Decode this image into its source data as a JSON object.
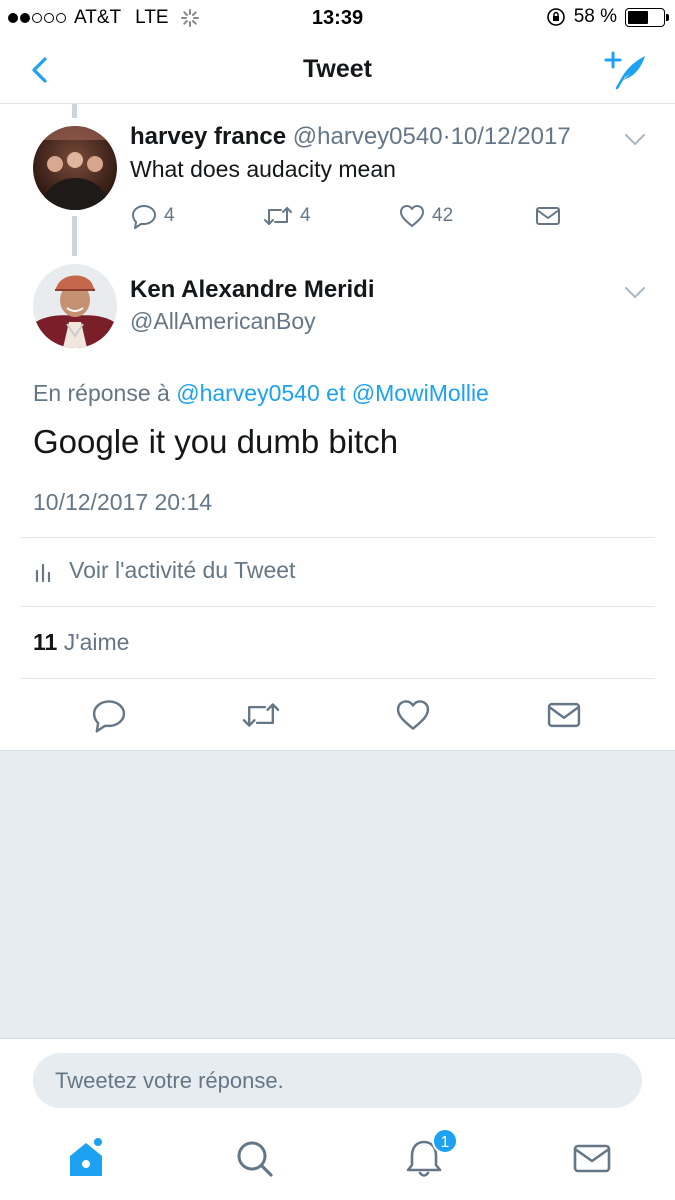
{
  "status_bar": {
    "carrier": "AT&T",
    "network": "LTE",
    "time": "13:39",
    "battery_text": "58 %",
    "battery_level": 0.58
  },
  "nav": {
    "title": "Tweet"
  },
  "parent_tweet": {
    "name": "harvey france",
    "handle": "@harvey0540",
    "separator": "·",
    "date": "10/12/2017",
    "text": "What does audacity mean",
    "replies": "4",
    "retweets": "4",
    "likes": "42"
  },
  "main_tweet": {
    "name": "Ken Alexandre Meridi",
    "handle": "@AllAmericanBoy",
    "reply_prefix": "En réponse à",
    "reply_user_1": "@harvey0540",
    "reply_conj": "et",
    "reply_user_2": "@MowiMollie",
    "text": "Google it you dumb bitch",
    "timestamp": "10/12/2017 20:14",
    "activity_label": "Voir l'activité du Tweet",
    "like_count": "11",
    "like_label": "J'aime"
  },
  "reply_bar": {
    "placeholder": "Tweetez votre réponse."
  },
  "tab_bar": {
    "notifications_badge": "1"
  },
  "colors": {
    "accent": "#1da1f2",
    "secondary_text": "#657786",
    "divider": "#e1e8ed",
    "background_gray": "#e6ecf0"
  },
  "icons": {
    "back": "chevron-left-icon",
    "compose": "compose-feather-icon",
    "reply": "reply-bubble-icon",
    "retweet": "retweet-icon",
    "like": "heart-icon",
    "dm": "envelope-icon",
    "activity": "bar-chart-icon",
    "home": "home-icon",
    "search": "search-icon",
    "notifications": "bell-icon",
    "messages": "envelope-icon"
  }
}
